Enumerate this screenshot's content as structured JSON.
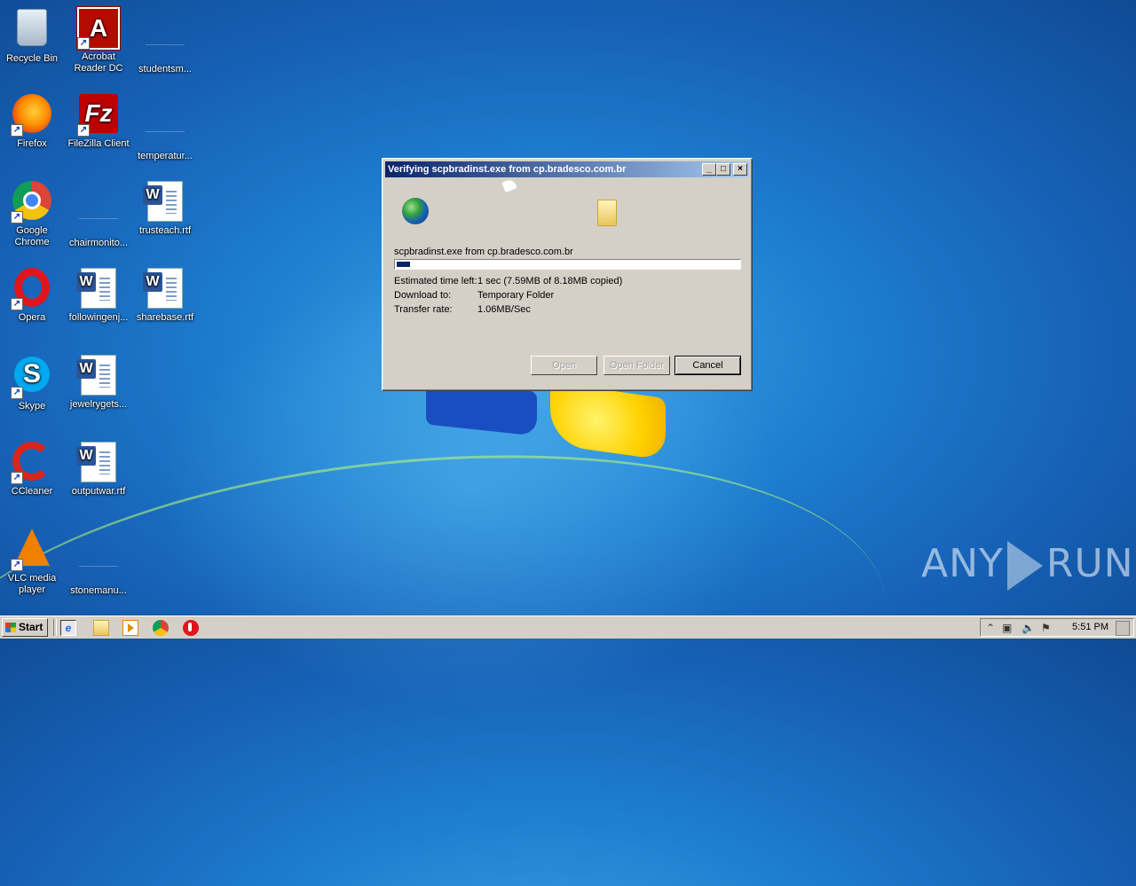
{
  "desktop": {
    "icons": [
      {
        "label": "Recycle Bin",
        "icon": "recycle-bin-icon"
      },
      {
        "label": "Acrobat Reader DC",
        "icon": "acrobat-icon"
      },
      {
        "label": "studentsm...",
        "icon": "file-icon"
      },
      {
        "label": "Firefox",
        "icon": "firefox-icon"
      },
      {
        "label": "FileZilla Client",
        "icon": "filezilla-icon"
      },
      {
        "label": "temperatur...",
        "icon": "file-icon"
      },
      {
        "label": "Google Chrome",
        "icon": "chrome-icon"
      },
      {
        "label": "chairmonito...",
        "icon": "file-icon"
      },
      {
        "label": "trusteach.rtf",
        "icon": "word-document-icon"
      },
      {
        "label": "Opera",
        "icon": "opera-icon"
      },
      {
        "label": "followingenj...",
        "icon": "word-document-icon"
      },
      {
        "label": "sharebase.rtf",
        "icon": "word-document-icon"
      },
      {
        "label": "Skype",
        "icon": "skype-icon"
      },
      {
        "label": "jewelrygets...",
        "icon": "word-document-icon"
      },
      {
        "label": "CCleaner",
        "icon": "ccleaner-icon"
      },
      {
        "label": "outputwar.rtf",
        "icon": "word-document-icon"
      },
      {
        "label": "VLC media player",
        "icon": "vlc-icon"
      },
      {
        "label": "stonemanu...",
        "icon": "file-icon"
      }
    ]
  },
  "dialog": {
    "title": "Verifying scpbradinst.exe from cp.bradesco.com.br",
    "file_line": "scpbradinst.exe from cp.bradesco.com.br",
    "progress_fraction": 0.04,
    "rows": [
      {
        "key": "Estimated time left:",
        "value": "1 sec (7.59MB of 8.18MB copied)"
      },
      {
        "key": "Download to:",
        "value": "Temporary Folder"
      },
      {
        "key": "Transfer rate:",
        "value": "1.06MB/Sec"
      }
    ],
    "buttons": {
      "open": "Open",
      "open_folder": "Open Folder",
      "cancel": "Cancel"
    }
  },
  "watermark": {
    "left": "ANY",
    "right": "RUN"
  },
  "taskbar": {
    "start_label": "Start",
    "clock": "5:51 PM"
  }
}
